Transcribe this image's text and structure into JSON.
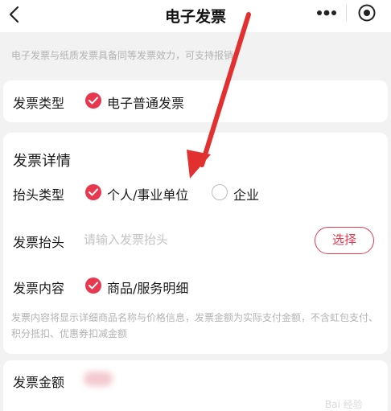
{
  "header": {
    "title": "电子发票"
  },
  "notice": "电子发票与纸质发票具备同等发票效力，可支持报销。",
  "invoice_type": {
    "label": "发票类型",
    "selected_option": "电子普通发票"
  },
  "details": {
    "section_title": "发票详情",
    "header_type": {
      "label": "抬头类型",
      "options": [
        {
          "label": "个人/事业单位",
          "selected": true
        },
        {
          "label": "企业",
          "selected": false
        }
      ]
    },
    "invoice_title": {
      "label": "发票抬头",
      "placeholder": "请输入发票抬头",
      "value": "",
      "select_button": "选择"
    },
    "content": {
      "label": "发票内容",
      "selected_option": "商品/服务明细"
    },
    "hint": "发票内容将显示详细商品名称与价格信息，发票金额为实际支付金额，不含虹包支付、积分抵扣、优惠券扣减金额"
  },
  "amount": {
    "label": "发票金额"
  },
  "colors": {
    "accent": "#e8384f",
    "annotation_arrow": "#e23030"
  }
}
